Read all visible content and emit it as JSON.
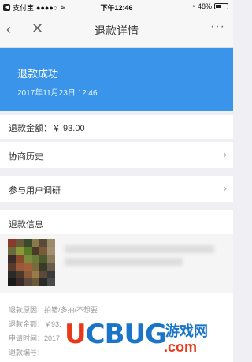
{
  "status_bar": {
    "carrier": "支付宝",
    "signal": "●●●●○",
    "time": "下午12:46",
    "battery": "48%"
  },
  "nav": {
    "title": "退款详情",
    "back_icon": "‹",
    "close_icon": "✕",
    "more_icon": "···"
  },
  "banner": {
    "status": "退款成功",
    "time": "2017年11月23日 12:46",
    "color": "#3a95ea"
  },
  "amount_row": {
    "label": "退款金额：￥ 93.00"
  },
  "history_row": {
    "label": "协商历史"
  },
  "survey_row": {
    "label": "参与用户调研"
  },
  "refund_info": {
    "title": "退款信息",
    "details": [
      "退款原因：拍错/多拍/不想要",
      "退款金额：￥93.",
      "申请时间：2017",
      "退款编号："
    ]
  },
  "watermark": {
    "text_ucbug": "UCBUG",
    "text_cn": "游戏网",
    "text_com": ".com"
  }
}
